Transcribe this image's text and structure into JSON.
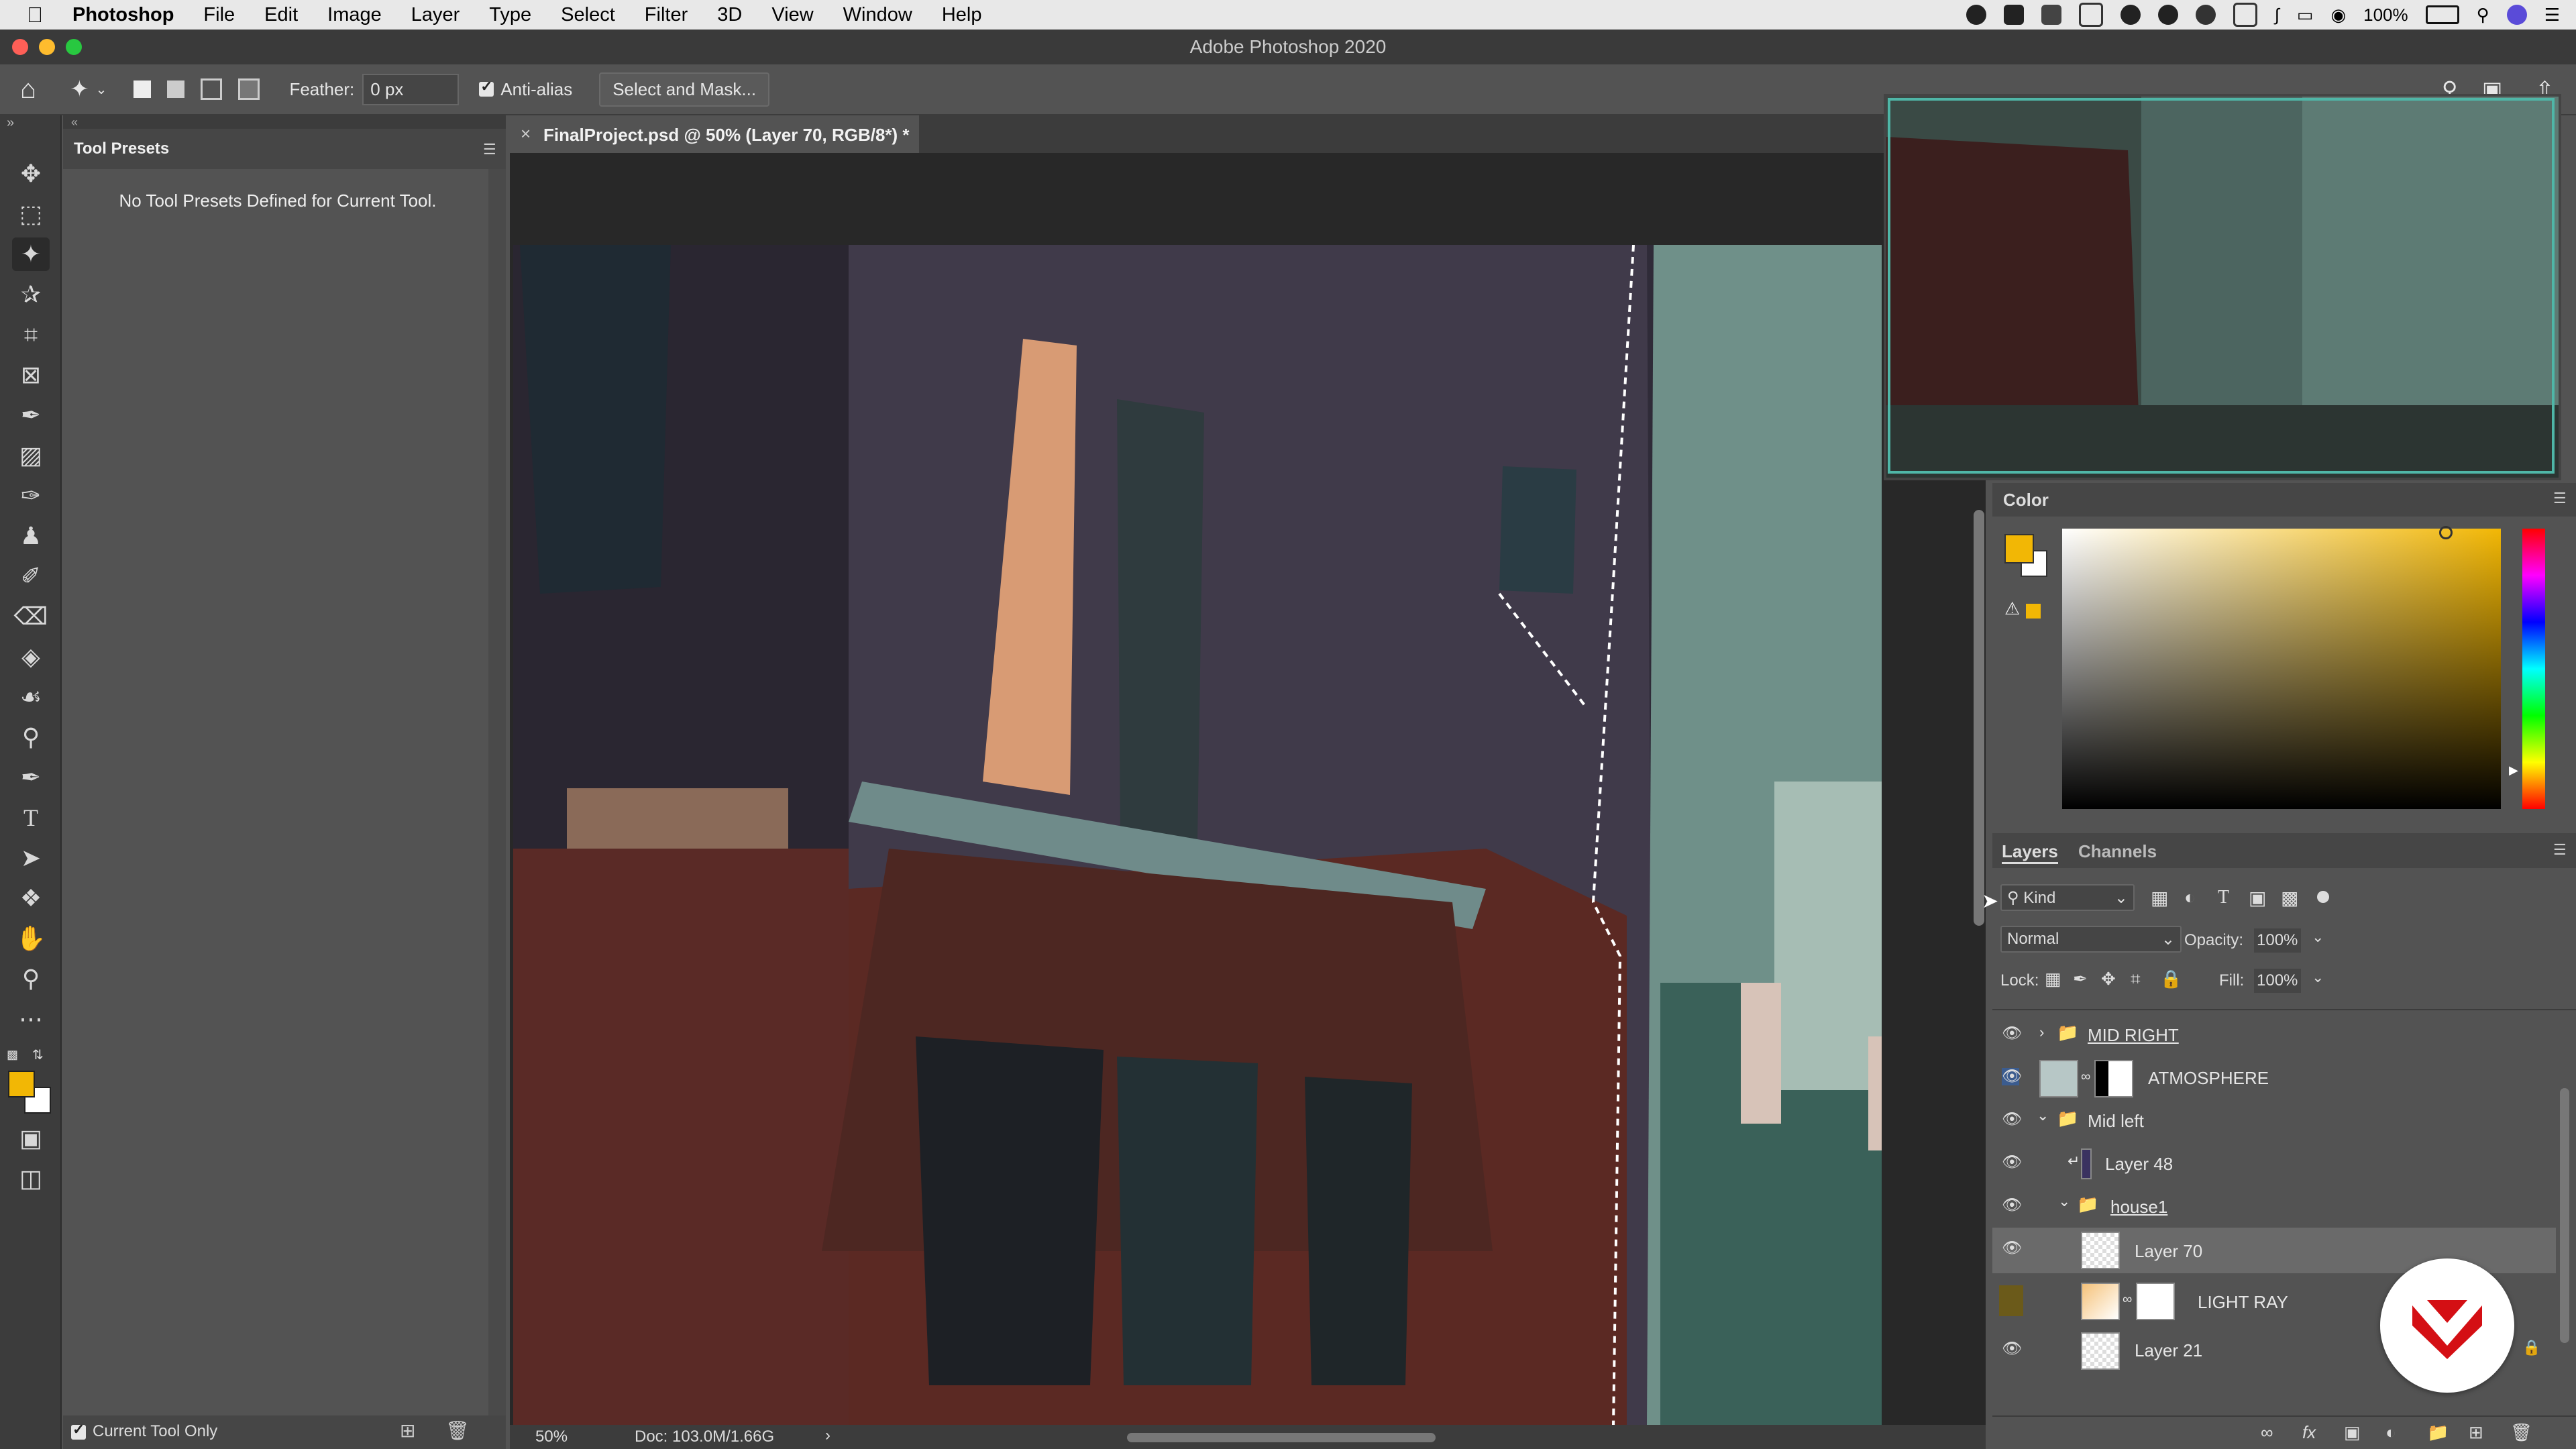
{
  "menubar": {
    "apple_icon": "apple-icon",
    "app": "Photoshop",
    "items": [
      "File",
      "Edit",
      "Image",
      "Layer",
      "Type",
      "Select",
      "Filter",
      "3D",
      "View",
      "Window",
      "Help"
    ],
    "battery": "100%",
    "system_icons": [
      "record-icon",
      "wd-icon",
      "dropbox-icon",
      "cast-icon",
      "creative-cloud-icon",
      "spotify-icon",
      "sync-icon",
      "display-icon",
      "bluetooth-icon",
      "airplay-icon",
      "wifi-icon",
      "battery-icon",
      "search-icon",
      "siri-icon",
      "menu-list-icon"
    ]
  },
  "window": {
    "title": "Adobe Photoshop 2020"
  },
  "options": {
    "feather_label": "Feather:",
    "feather_value": "0 px",
    "antialias_label": "Anti-alias",
    "select_mask_label": "Select and Mask..."
  },
  "tool_presets": {
    "title": "Tool Presets",
    "empty_text": "No Tool Presets Defined for Current Tool.",
    "current_tool_only": "Current Tool Only"
  },
  "document": {
    "tab_title": "FinalProject.psd @ 50% (Layer 70, RGB/8*) *",
    "zoom": "50%",
    "doc_info": "Doc: 103.0M/1.66G"
  },
  "color_panel": {
    "title": "Color",
    "foreground": "#f2b705",
    "background": "#ffffff"
  },
  "layers_panel": {
    "tabs": [
      "Layers",
      "Channels"
    ],
    "filter_kind": "Kind",
    "blend_mode": "Normal",
    "opacity_label": "Opacity:",
    "opacity_value": "100%",
    "lock_label": "Lock:",
    "fill_label": "Fill:",
    "fill_value": "100%",
    "layers": [
      {
        "name": "MID RIGHT",
        "type": "group",
        "collapsed": true,
        "visible": true
      },
      {
        "name": "ATMOSPHERE",
        "type": "layer-mask",
        "visible": true
      },
      {
        "name": "Mid left",
        "type": "group",
        "collapsed": false,
        "visible": true
      },
      {
        "name": "Layer 48",
        "type": "clipped",
        "visible": true
      },
      {
        "name": "house1",
        "type": "group",
        "collapsed": false,
        "visible": true
      },
      {
        "name": "Layer 70",
        "type": "layer",
        "selected": true,
        "visible": true
      },
      {
        "name": "LIGHT RAY",
        "type": "layer-mask",
        "visible": false
      },
      {
        "name": "Layer 21",
        "type": "layer",
        "locked": true,
        "visible": true
      }
    ]
  }
}
